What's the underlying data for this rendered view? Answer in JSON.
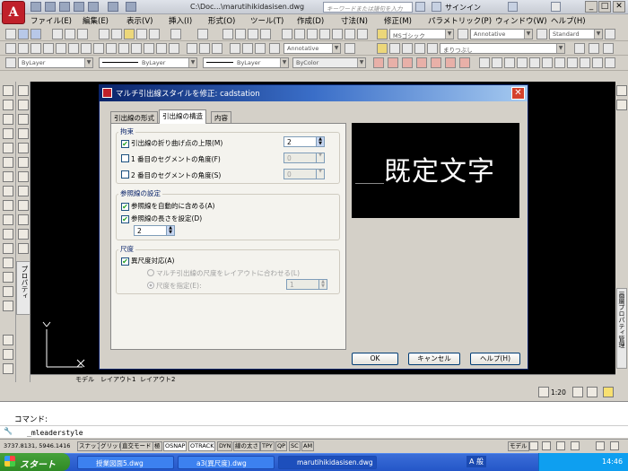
{
  "app": {
    "logo_letter": "A",
    "doc_title": "C:\\Doc...\\marutihikidasisen.dwg",
    "search_placeholder": "キーワードまたは語句を入力",
    "signin": "サインイン"
  },
  "menu": [
    "ファイル(E)",
    "編集(E)",
    "表示(V)",
    "挿入(I)",
    "形式(O)",
    "ツール(T)",
    "作成(D)",
    "寸法(N)",
    "修正(M)",
    "パラメトリック(P)",
    "ウィンドウ(W)",
    "ヘルプ(H)"
  ],
  "toolbar": {
    "text_style": "MSゴシック",
    "annotative1": "Annotative",
    "standard": "Standard",
    "annotative2": "Annotative",
    "font_name": "まりつぶし",
    "layer": "ByLayer",
    "linetype": "ByLayer",
    "lineweight": "ByLayer",
    "plotstyle": "ByColor"
  },
  "dialog": {
    "title": "マルチ引出線スタイルを修正: cadstation",
    "close": "✕",
    "tabs": [
      "引出線の形式",
      "引出線の構造",
      "内容"
    ],
    "constraints": {
      "label": "拘束",
      "max_points_label": "引出線の折り曲げ点の上限(M)",
      "max_points_value": "2",
      "first_angle_label": "1 番目のセグメントの角度(F)",
      "first_angle_value": "0",
      "second_angle_label": "2 番目のセグメントの角度(S)",
      "second_angle_value": "0"
    },
    "landing": {
      "label": "参照線の設定",
      "auto_include_label": "参照線を自動的に含める(A)",
      "set_distance_label": "参照線の長さを設定(D)",
      "distance_value": "2"
    },
    "scale": {
      "label": "尺度",
      "annotative_label": "異尺度対応(A)",
      "layout_label": "マルチ引出線の尺度をレイアウトに合わせる(L)",
      "specify_label": "尺度を指定(E):",
      "specify_value": "1"
    },
    "preview_text": "既定文字",
    "buttons": {
      "ok": "OK",
      "cancel": "キャンセル",
      "help": "ヘルプ(H)"
    }
  },
  "side_panels": {
    "left": "プロパティ",
    "right": "画層プロパティ管理"
  },
  "layout_tabs": [
    "モデル",
    "レイアウト1",
    "レイアウト2"
  ],
  "annotation_scale": "1:20",
  "command": {
    "prompt": "コマンド:",
    "history": "_mleaderstyle"
  },
  "status": {
    "coords": "3737.8131, 5946.1416",
    "buttons": [
      "スナップ",
      "グリッド",
      "直交モード",
      "極",
      "OSNAP",
      "OTRACK",
      "DYN",
      "線の太さ",
      "TPY",
      "QP",
      "SC",
      "AM"
    ],
    "model": "モデル"
  },
  "taskbar": {
    "start": "スタート",
    "tasks": [
      "授業図面5.dwg",
      "a3(異尺度).dwg",
      "marutihikidasisen.dwg"
    ],
    "ime": "A 般",
    "time": "14:46"
  }
}
